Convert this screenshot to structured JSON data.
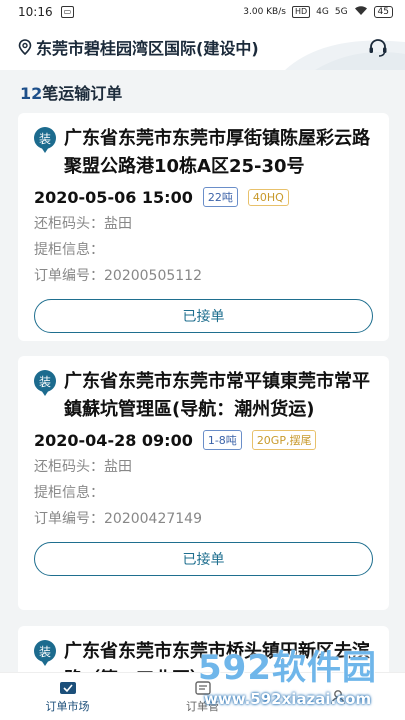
{
  "status_bar": {
    "time": "10:16",
    "net_speed": "3.00 KB/s",
    "hd": "HD",
    "net1": "4G",
    "net2": "5G",
    "battery": "45"
  },
  "header": {
    "location": "东莞市碧桂园湾区国际(建设中)"
  },
  "summary": {
    "count": "12",
    "label": "笔运输订单"
  },
  "orders": [
    {
      "badge": "装",
      "address": "广东省东莞市东莞市厚街镇陈屋彩云路聚盟公路港10栋A区25-30号",
      "datetime": "2020-05-06 15:00",
      "weight": "22吨",
      "container": "40HQ",
      "return_label": "还柜码头：",
      "return_value": "盐田",
      "pickup_label": "提柜信息：",
      "pickup_value": "",
      "order_label": "订单编号：",
      "order_no": "20200505112",
      "button": "已接单"
    },
    {
      "badge": "装",
      "address": "广东省东莞市东莞市常平镇東莞市常平鎮蘇坑管理區(导航：潮州货运)",
      "datetime": "2020-04-28 09:00",
      "weight": "1-8吨",
      "container": "20GP,摆尾",
      "return_label": "还柜码头：",
      "return_value": "盐田",
      "pickup_label": "提柜信息：",
      "pickup_value": "",
      "order_label": "订单编号：",
      "order_no": "20200427149",
      "button": "已接单"
    },
    {
      "badge": "装",
      "address": "广东省东莞市东莞市桥头镇田新区去滨路（篇一工业园）"
    }
  ],
  "tabs": [
    {
      "label": "订单市场"
    },
    {
      "label": "订单管"
    }
  ],
  "watermark": {
    "brand": "592软件园",
    "url": "www.592xiazai.com"
  },
  "colors": {
    "accent": "#1c6b8e",
    "tag_blue": "#3b62a8",
    "tag_yellow": "#c89a2c"
  }
}
